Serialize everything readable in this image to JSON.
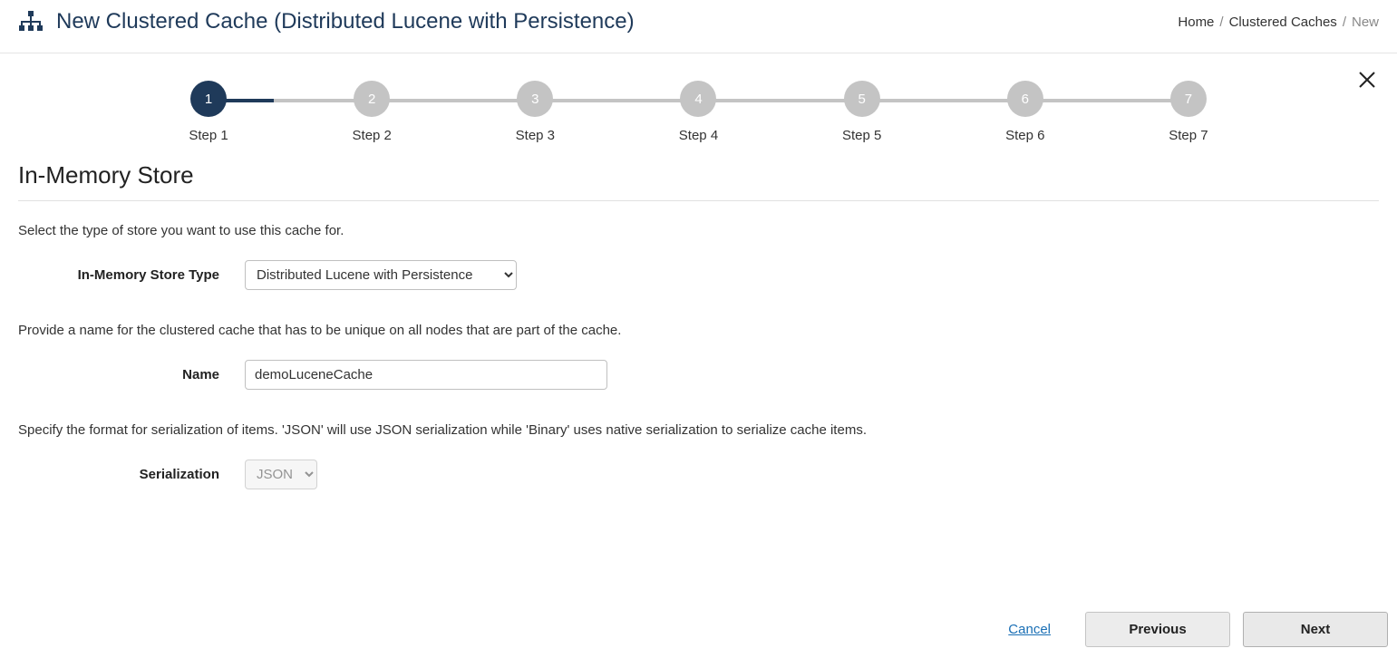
{
  "header": {
    "title": "New Clustered Cache (Distributed Lucene with Persistence)"
  },
  "breadcrumb": {
    "home": "Home",
    "clustered_caches": "Clustered Caches",
    "current": "New"
  },
  "steps": [
    {
      "num": "1",
      "label": "Step 1",
      "active": true
    },
    {
      "num": "2",
      "label": "Step 2",
      "active": false
    },
    {
      "num": "3",
      "label": "Step 3",
      "active": false
    },
    {
      "num": "4",
      "label": "Step 4",
      "active": false
    },
    {
      "num": "5",
      "label": "Step 5",
      "active": false
    },
    {
      "num": "6",
      "label": "Step 6",
      "active": false
    },
    {
      "num": "7",
      "label": "Step 7",
      "active": false
    }
  ],
  "section_title": "In-Memory Store",
  "desc_store_type": "Select the type of store you want to use this cache for.",
  "store_type": {
    "label": "In-Memory Store Type",
    "selected": "Distributed Lucene with Persistence"
  },
  "desc_name": "Provide a name for the clustered cache that has to be unique on all nodes that are part of the cache.",
  "name_field": {
    "label": "Name",
    "value": "demoLuceneCache"
  },
  "desc_serialization": "Specify the format for serialization of items. 'JSON' will use JSON serialization while 'Binary' uses native serialization to serialize cache items.",
  "serialization": {
    "label": "Serialization",
    "selected": "JSON"
  },
  "footer": {
    "cancel": "Cancel",
    "previous": "Previous",
    "next": "Next"
  }
}
